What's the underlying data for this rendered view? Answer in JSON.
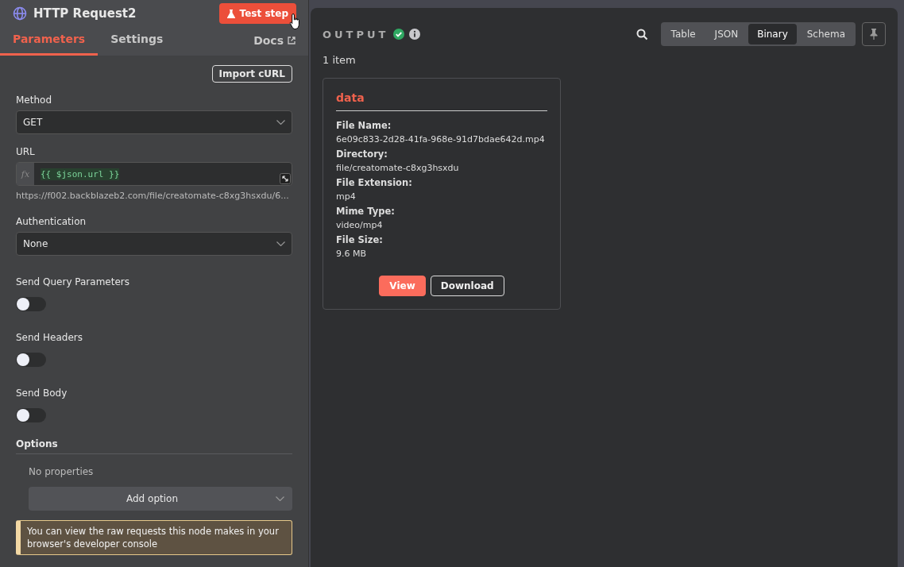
{
  "node": {
    "title": "HTTP Request2",
    "test_button": "Test step"
  },
  "tabs": [
    {
      "label": "Parameters",
      "selected": true
    },
    {
      "label": "Settings",
      "selected": false
    }
  ],
  "docs_link": "Docs",
  "import_button": "Import cURL",
  "fields": [
    {
      "kind": "select",
      "label": "Method",
      "value": "GET"
    },
    {
      "kind": "expression",
      "label": "URL",
      "prefix": "fx",
      "value": "{{ $json.url }}",
      "hint": "https://f002.backblazeb2.com/file/creatomate-c8xg3hsxdu/6..."
    },
    {
      "kind": "select",
      "label": "Authentication",
      "value": "None"
    },
    {
      "kind": "toggle",
      "label": "Send Query Parameters",
      "on": false
    },
    {
      "kind": "toggle",
      "label": "Send Headers",
      "on": false
    },
    {
      "kind": "toggle",
      "label": "Send Body",
      "on": false
    }
  ],
  "options": {
    "title": "Options",
    "empty_text": "No properties",
    "add_button": "Add option"
  },
  "notice": "You can view the raw requests this node makes in your browser's developer console",
  "output": {
    "title": "OUTPUT",
    "views": [
      {
        "label": "Table",
        "selected": false
      },
      {
        "label": "JSON",
        "selected": false
      },
      {
        "label": "Binary",
        "selected": true
      },
      {
        "label": "Schema",
        "selected": false
      }
    ],
    "item_count": "1 item",
    "card": {
      "title": "data",
      "rows": [
        {
          "label": "File Name:",
          "value": "6e09c833-2d28-41fa-968e-91d7bdae642d.mp4"
        },
        {
          "label": "Directory:",
          "value": "file/creatomate-c8xg3hsxdu"
        },
        {
          "label": "File Extension:",
          "value": "mp4"
        },
        {
          "label": "Mime Type:",
          "value": "video/mp4"
        },
        {
          "label": "File Size:",
          "value": "9.6 MB"
        }
      ],
      "buttons": [
        {
          "label": "View",
          "kind": "primary"
        },
        {
          "label": "Download",
          "kind": "secondary"
        }
      ]
    }
  }
}
